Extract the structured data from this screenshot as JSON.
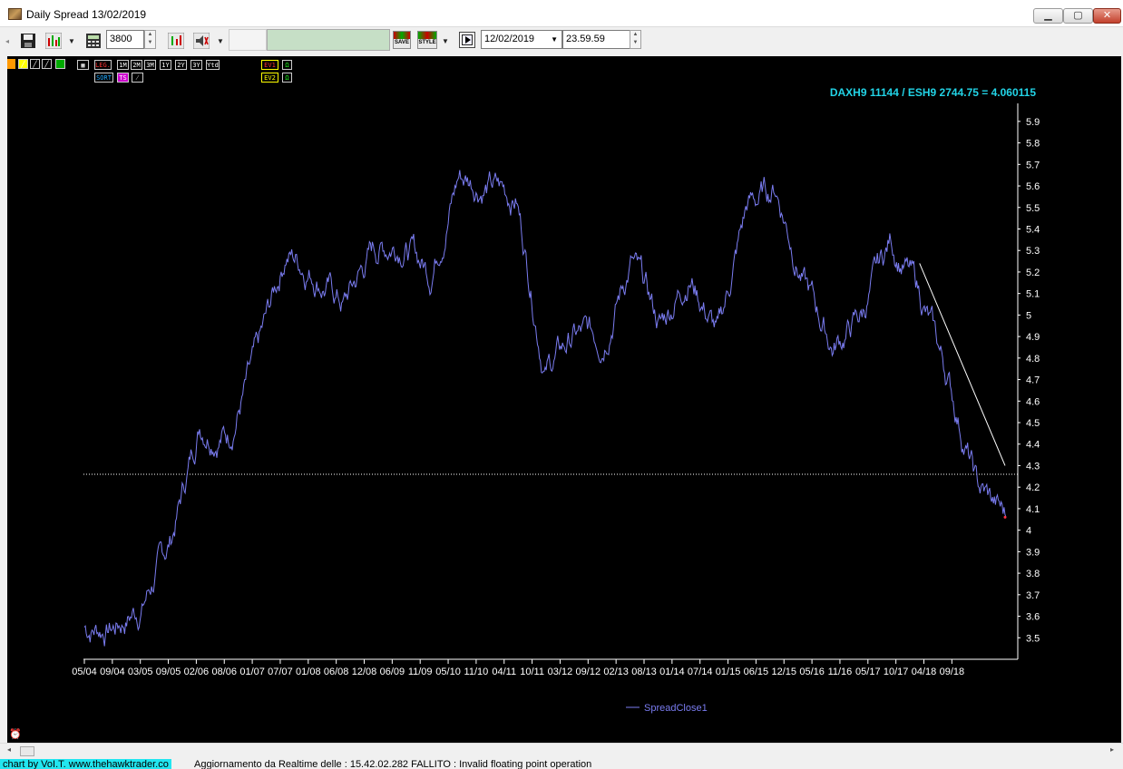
{
  "window": {
    "title": "Daily Spread 13/02/2019",
    "minimize_label": "▁",
    "maximize_label": "▢",
    "close_label": "✕"
  },
  "toolbar": {
    "bars_value": "3800",
    "start_date": "12/02/2019",
    "time_value": "23.59.59",
    "save_label": "SAVE",
    "style_label": "STYLE"
  },
  "small_toolbar": {
    "row1": [
      "LEG.",
      "1M",
      "2M",
      "3M",
      "1Y",
      "2Y",
      "3Y",
      "Ytd"
    ],
    "row2": [
      "SORT",
      "TS"
    ],
    "ev1": "EV1",
    "ev2": "EV2"
  },
  "chart_header": "DAXH9 11144 / ESH9 2744.75 = 4.060115",
  "chart_data": {
    "type": "line",
    "title": "DAXH9 11144 / ESH9 2744.75 = 4.060115",
    "ylim": [
      3.4,
      5.95
    ],
    "y_ticks": [
      "3.5",
      "3.6",
      "3.7",
      "3.8",
      "3.9",
      "4",
      "4.1",
      "4.2",
      "4.3",
      "4.4",
      "4.5",
      "4.6",
      "4.7",
      "4.8",
      "4.9",
      "5",
      "5.1",
      "5.2",
      "5.3",
      "5.4",
      "5.5",
      "5.6",
      "5.7",
      "5.8",
      "5.9"
    ],
    "x_ticks": [
      "05/04",
      "09/04",
      "03/05",
      "09/05",
      "02/06",
      "08/06",
      "01/07",
      "07/07",
      "01/08",
      "06/08",
      "12/08",
      "06/09",
      "11/09",
      "05/10",
      "11/10",
      "04/11",
      "10/11",
      "03/12",
      "09/12",
      "02/13",
      "08/13",
      "01/14",
      "07/14",
      "01/15",
      "06/15",
      "12/15",
      "05/16",
      "11/16",
      "05/17",
      "10/17",
      "04/18",
      "09/18"
    ],
    "series": [
      {
        "name": "SpreadClose1",
        "color": "#7a7cf0",
        "x": [
          "05/04",
          "09/04",
          "03/05",
          "09/05",
          "02/06",
          "08/06",
          "01/07",
          "07/07",
          "01/08",
          "06/08",
          "12/08",
          "06/09",
          "11/09",
          "05/10",
          "11/10",
          "04/11",
          "10/11",
          "03/12",
          "09/12",
          "02/13",
          "08/13",
          "01/14",
          "07/14",
          "01/15",
          "06/15",
          "12/15",
          "05/16",
          "11/16",
          "05/17",
          "10/17",
          "04/18",
          "09/18",
          "02/19"
        ],
        "values": [
          3.55,
          3.55,
          3.65,
          3.95,
          4.5,
          4.45,
          4.8,
          5.3,
          5.2,
          5.05,
          5.3,
          5.35,
          5.2,
          5.65,
          5.6,
          5.55,
          4.75,
          4.9,
          4.9,
          5.25,
          4.95,
          5.2,
          4.9,
          5.5,
          5.6,
          5.15,
          4.85,
          5.0,
          5.35,
          5.1,
          4.7,
          4.2,
          4.06
        ]
      }
    ],
    "horizontal_line": 4.26,
    "trendline": {
      "from": [
        "10/17",
        5.24
      ],
      "to": [
        "02/19",
        4.3
      ]
    },
    "legend": "bottom-center"
  },
  "legend_label": "SpreadClose1",
  "status": {
    "credit": "chart by VoI.T. www.thehawktrader.co",
    "message": "Aggiornamento da Realtime    delle : 15.42.02.282 FALLITO : Invalid floating point operation"
  }
}
